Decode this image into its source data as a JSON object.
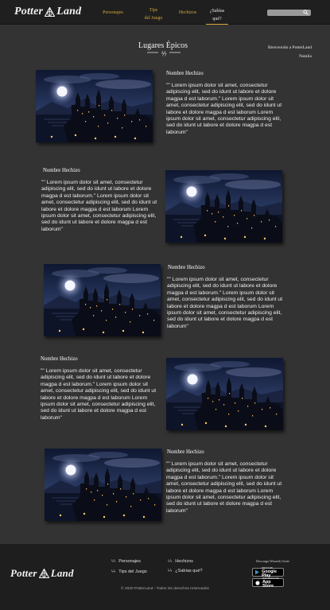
{
  "brand": {
    "name_left": "Potter",
    "name_right": "Land"
  },
  "nav": {
    "items": [
      {
        "label": "Personajes"
      },
      {
        "label_line1": "Tips",
        "label_line2": "del Juego"
      },
      {
        "label": "Hechizos"
      },
      {
        "label_line1": "¿Sabías",
        "label_line2": "qué?"
      }
    ]
  },
  "search": {
    "placeholder": ""
  },
  "page": {
    "title": "Lugares Épicos"
  },
  "welcome": {
    "line1": "Bienvenido a PotterLand",
    "line2": "Natalia"
  },
  "articles": [
    {
      "name": "Nombre Hechizo",
      "text": "\"\" Lorem ipsum dolor sit amet, consectetur adipiscing elit, sed do idunt ut labore et dolore magpa d est laborum.\" Lorem ipsum dolor sit amet, consectetur adipiscing elit, sed do idunt ut labore et dolore magpa d est laborum Lorem ipsum dolor sit amet, consectetur adipiscing elit, sed do idunt ut labore et dolore magpa d est laborum\""
    },
    {
      "name": "Nombre Hechizo",
      "text": "\"\" Lorem ipsum dolor sit amet, consectetur adipiscing elit, sed do idunt ut labore et dolore magpa d est laborum.\" Lorem ipsum dolor sit amet, consectetur adipiscing elit, sed do idunt ut labore et dolore magpa d est laborum Lorem ipsum dolor sit amet, consectetur adipiscing elit, sed do idunt ut labore et dolore magpa d est laborum\""
    },
    {
      "name": "Nombre Hechizo",
      "text": "\"\" Lorem ipsum dolor sit amet, consectetur adipiscing elit, sed do idunt ut labore et dolore magpa d est laborum.\" Lorem ipsum dolor sit amet, consectetur adipiscing elit, sed do idunt ut labore et dolore magpa d est laborum Lorem ipsum dolor sit amet, consectetur adipiscing elit, sed do idunt ut labore et dolore magpa d est laborum\""
    },
    {
      "name": "Nombre Hechizo",
      "text": "\"\" Lorem ipsum dolor sit amet, consectetur adipiscing elit, sed do idunt ut labore et dolore magpa d est laborum.\" Lorem ipsum dolor sit amet, consectetur adipiscing elit, sed do idunt ut labore et dolore magpa d est laborum Lorem ipsum dolor sit amet, consectetur adipiscing elit, sed do idunt ut labore et dolore magpa d est laborum\""
    },
    {
      "name": "Nombre Hechizo",
      "text": "\"\" Lorem ipsum dolor sit amet, consectetur adipiscing elit, sed do idunt ut labore et dolore magpa d est laborum.\" Lorem ipsum dolor sit amet, consectetur adipiscing elit, sed do idunt ut labore et dolore magpa d est laborum Lorem ipsum dolor sit amet, consectetur adipiscing elit, sed do idunt ut labore et dolore magpa d est laborum\""
    }
  ],
  "footer": {
    "links": [
      {
        "label": "Personajes"
      },
      {
        "label": "Hechizos"
      },
      {
        "label": "Tips del Juego"
      },
      {
        "label": "¿Sabías qué?"
      }
    ],
    "download_label": "Descarga Wizards Unite",
    "google_play": {
      "small": "GET IT ON",
      "big": "Google Play"
    },
    "app_store": {
      "small": "Download on the",
      "big": "App Store"
    },
    "copyright": "© 2020 PotterLand -  Todos los derechos reservados"
  },
  "colors": {
    "accent": "#d4a73d",
    "background": "#333333",
    "header": "#1f1f1f"
  },
  "icons": {
    "search": "magnifier-icon",
    "bullet": "lightning-bolt-icon"
  }
}
